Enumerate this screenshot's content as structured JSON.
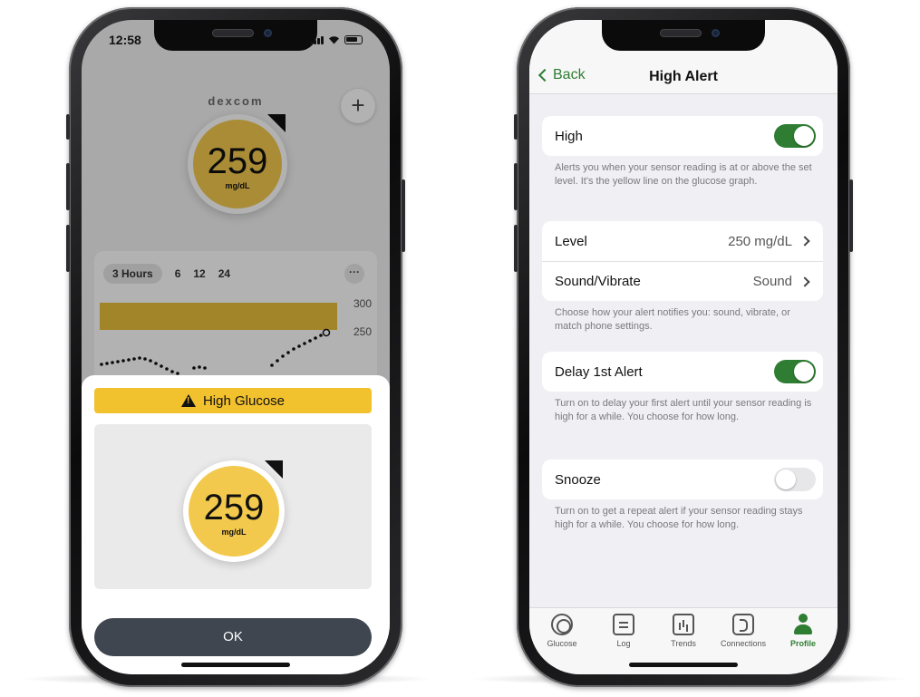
{
  "left_phone": {
    "status_time": "12:58",
    "brand": "dexcom",
    "plus_label": "+",
    "reading": {
      "value": "259",
      "unit": "mg/dL"
    },
    "graph": {
      "range_tabs": [
        "3 Hours",
        "6",
        "12",
        "24"
      ],
      "active_range": "3 Hours",
      "more_label": "···",
      "y_labels": [
        "300",
        "250"
      ]
    },
    "alert": {
      "title": "High Glucose",
      "value": "259",
      "unit": "mg/dL",
      "ok_label": "OK"
    }
  },
  "right_phone": {
    "nav": {
      "back_label": "Back",
      "title": "High Alert"
    },
    "high": {
      "label": "High",
      "enabled": true,
      "note": "Alerts you when your sensor reading is at or above the set level. It's the yellow line on the glucose graph."
    },
    "level": {
      "label": "Level",
      "value": "250 mg/dL"
    },
    "sound": {
      "label": "Sound/Vibrate",
      "value": "Sound",
      "note": "Choose how your alert notifies you: sound, vibrate, or match phone settings."
    },
    "delay": {
      "label": "Delay 1st Alert",
      "enabled": true,
      "note": "Turn on to delay your first alert until your sensor reading is high for a while. You choose for how long."
    },
    "snooze": {
      "label": "Snooze",
      "enabled": false,
      "note": "Turn on to get a repeat alert if your sensor reading stays high for a while. You choose for how long."
    },
    "tabs": [
      {
        "label": "Glucose",
        "icon": "glucose-icon"
      },
      {
        "label": "Log",
        "icon": "log-icon"
      },
      {
        "label": "Trends",
        "icon": "trends-icon"
      },
      {
        "label": "Connections",
        "icon": "connections-icon"
      },
      {
        "label": "Profile",
        "icon": "profile-icon",
        "active": true
      }
    ]
  },
  "colors": {
    "accent_green": "#2e7d32",
    "glucose_yellow": "#f2c94c",
    "alert_banner": "#f2c12e",
    "ok_button": "#3f4650"
  }
}
